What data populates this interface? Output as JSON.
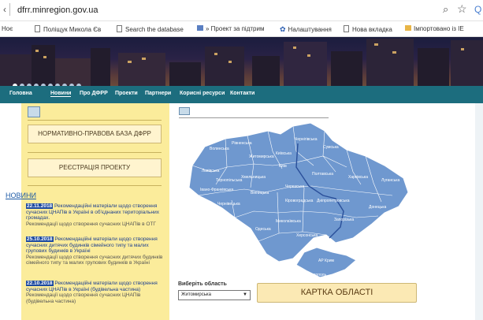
{
  "browser": {
    "back_glyph": "‹",
    "url": "dfrr.minregion.gov.ua",
    "zoom_glyph": "⌕",
    "star_glyph": "☆",
    "ext_glyph": "Q"
  },
  "bookmarks": [
    {
      "label": "Ноє"
    },
    {
      "label": "Поліщук Микола Єв"
    },
    {
      "label": "Search the database"
    },
    {
      "label": "» Проект за підтрим"
    },
    {
      "label": "Налаштування"
    },
    {
      "label": "Нова вкладка"
    },
    {
      "label": "Імпортовано із IE"
    }
  ],
  "nav": {
    "items": [
      {
        "label": "Головна"
      },
      {
        "label": "Новини"
      },
      {
        "label": "Про ДФРР"
      },
      {
        "label": "Проекти"
      },
      {
        "label": "Партнери"
      },
      {
        "label": "Корисні ресурси"
      },
      {
        "label": "Контакти"
      }
    ]
  },
  "sidebar": {
    "button_regulatory": "НОРМАТИВНО-ПРАВОВА БАЗА ДФРР",
    "button_register": "РЕЄСТРАЦІЯ ПРОЕКТУ",
    "news_heading": "НОВИНИ",
    "news": [
      {
        "date": "22.11.2018",
        "title": "Рекомендаційні матеріали щодо створення сучасних ЦНАПів в Україні в об'єднаних територіальних громадах.",
        "subtitle": "Рекомендації щодо створення сучасних ЦНАПів в ОТГ"
      },
      {
        "date": "25.10.2018",
        "title": "Рекомендаційні матеріали щодо створення сучасних дитячих будинків сімейного типу та малих групових будинків в Україні",
        "subtitle": "Рекомендації щодо створення сучасних дитячих будинків сімейного типу та малих групових будинків в Україні"
      },
      {
        "date": "22.10.2018",
        "title": "Рекомендаційні матеріали щодо створення сучасних ЦНАПів в Україні (будівельна частина)",
        "subtitle": "Рекомендації щодо створення сучасних ЦНАПів (будівельна частина)"
      }
    ]
  },
  "map": {
    "fill": "#6f98cf",
    "regions": {
      "volynska": "Волинська",
      "rivnenska": "Рівненська",
      "zhytomyrska": "Житомирська",
      "kyivska": "Київська",
      "chernihivska": "Чернігівська",
      "sumska": "Сумська",
      "lvivska": "Львівська",
      "ternopilska": "Тернопільська",
      "khmelnytska": "Хмельницька",
      "vinnytska": "Вінницька",
      "kyiv": "Київ",
      "poltavska": "Полтавська",
      "kharkivska": "Харківська",
      "luhanska": "Луганська",
      "ivano_frankivska": "Івано-Франківська",
      "zakarpatska": "Закарпатська",
      "chernivetska": "Чернівецька",
      "cherkaska": "Черкаська",
      "kirovohradska": "Кіровоградська",
      "dnipropetrovska": "Дніпропетровська",
      "donetska": "Донецька",
      "mykolaivska": "Миколаївська",
      "zaporizka": "Запорізька",
      "odeska": "Одеська",
      "khersonska": "Херсонська",
      "ar_krym": "АР Крим",
      "sevastopol": "Севастополь"
    }
  },
  "region_select": {
    "label": "Виберіть область",
    "value": "Житомирська",
    "arrow": "▼"
  },
  "map_button": "КАРТКА ОБЛАСТІ"
}
